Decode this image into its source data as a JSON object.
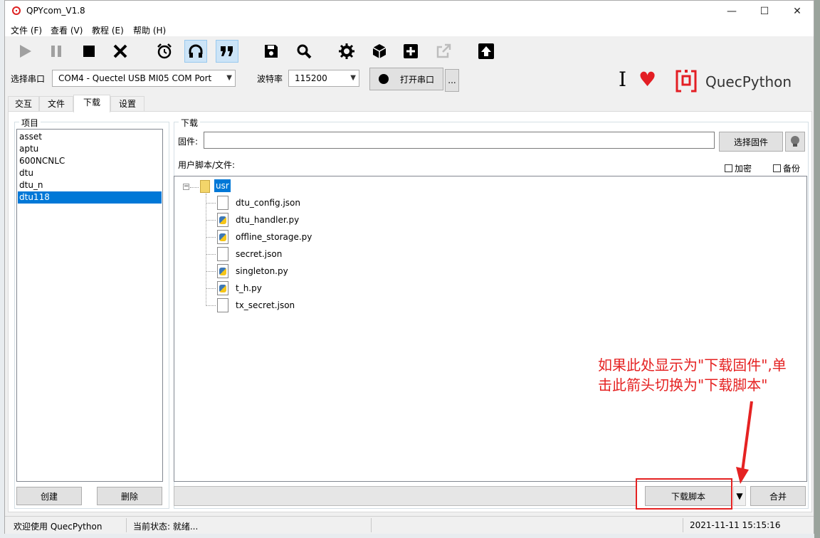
{
  "window": {
    "title": "QPYcom_V1.8",
    "min_symbol": "—",
    "max_symbol": "☐",
    "close_symbol": "✕"
  },
  "menu": [
    {
      "label": "文件 (F)"
    },
    {
      "label": "查看 (V)"
    },
    {
      "label": "教程 (E)"
    },
    {
      "label": "帮助 (H)"
    }
  ],
  "toolbar": {
    "icons": [
      "play-icon",
      "pause-icon",
      "stop-icon",
      "close-icon",
      "alarm-clock-icon",
      "headset-icon",
      "quote-icon",
      "save-icon",
      "search-icon",
      "gear-icon",
      "cube-icon",
      "plus-icon",
      "export-icon",
      "upload-icon"
    ]
  },
  "serial": {
    "port_label": "选择串口",
    "port_value": "COM4 - Quectel USB MI05 COM Port",
    "baud_label": "波特率",
    "baud_value": "115200",
    "open_button": "打开串口",
    "more_button": "..."
  },
  "brand": {
    "cursor_glyph": "I",
    "heart_glyph": "♥",
    "name": "QuecPython",
    "accent": "#e31e24"
  },
  "tabs": [
    {
      "label": "交互"
    },
    {
      "label": "文件"
    },
    {
      "label": "下载"
    },
    {
      "label": "设置"
    }
  ],
  "project": {
    "group_title": "项目",
    "items": [
      "asset",
      "aptu",
      "600NCNLC",
      "dtu",
      "dtu_n",
      "dtu118"
    ],
    "selected_index": 5,
    "create_button": "创建",
    "delete_button": "删除"
  },
  "download": {
    "group_title": "下载",
    "firmware_label": "固件:",
    "firmware_value": "",
    "choose_firmware_button": "选择固件",
    "scripts_label": "用户脚本/文件:",
    "encrypt_label": "加密",
    "backup_label": "备份",
    "tree": {
      "root": "usr",
      "expand_symbol": "−",
      "files": [
        {
          "name": "dtu_config.json",
          "type": "json"
        },
        {
          "name": "dtu_handler.py",
          "type": "py"
        },
        {
          "name": "offline_storage.py",
          "type": "py"
        },
        {
          "name": "secret.json",
          "type": "json"
        },
        {
          "name": "singleton.py",
          "type": "py"
        },
        {
          "name": "t_h.py",
          "type": "py"
        },
        {
          "name": "tx_secret.json",
          "type": "json"
        }
      ]
    },
    "download_script_button": "下载脚本",
    "dropdown_arrow": "▼",
    "merge_button": "合并"
  },
  "annotation": {
    "line1": "如果此处显示为\"下载固件\",单",
    "line2": "击此箭头切换为\"下载脚本\"",
    "color": "#e52222"
  },
  "status": {
    "welcome": "欢迎使用 QuecPython",
    "state": "当前状态: 就绪...",
    "datetime": "2021-11-11 15:15:16"
  }
}
